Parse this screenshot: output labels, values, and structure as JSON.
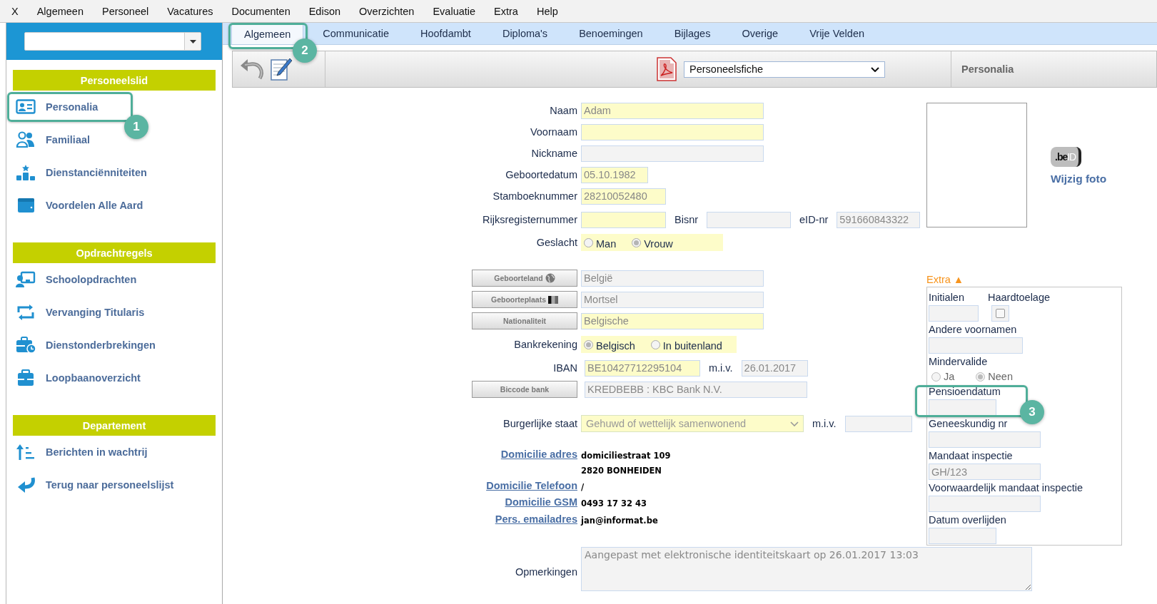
{
  "menu": [
    "X",
    "Algemeen",
    "Personeel",
    "Vacatures",
    "Documenten",
    "Edison",
    "Overzichten",
    "Evaluatie",
    "Extra",
    "Help"
  ],
  "sidebar": {
    "sections": [
      {
        "title": "Personeelslid",
        "items": [
          "Personalia",
          "Familiaal",
          "Dienstanciënniteiten",
          "Voordelen Alle Aard"
        ]
      },
      {
        "title": "Opdrachtregels",
        "items": [
          "Schoolopdrachten",
          "Vervanging Titularis",
          "Dienstonderbrekingen",
          "Loopbaanoverzicht"
        ]
      },
      {
        "title": "Departement",
        "items": [
          "Berichten in wachtrij",
          "Terug naar personeelslijst"
        ]
      }
    ]
  },
  "tabs": [
    {
      "label": "Algemeen",
      "selected": true
    },
    {
      "label": "Communicatie",
      "selected": false
    },
    {
      "label": "Hoofdambt",
      "selected": false
    },
    {
      "label": "Diploma's",
      "selected": false
    },
    {
      "label": "Benoemingen",
      "selected": false
    },
    {
      "label": "Bijlages",
      "selected": false
    },
    {
      "label": "Overige",
      "selected": false
    },
    {
      "label": "Vrije Velden",
      "selected": false
    }
  ],
  "toolbar": {
    "report": "Personeelsfiche",
    "title": "Personalia"
  },
  "form": {
    "rows": [
      {
        "kind": "fields",
        "label": "Naam",
        "items": [
          {
            "kind": "input",
            "value": "Adam",
            "required": true
          }
        ]
      },
      {
        "kind": "fields",
        "label": "Voornaam",
        "items": [
          {
            "kind": "input",
            "required": true
          }
        ]
      },
      {
        "kind": "fields",
        "label": "Nickname",
        "items": [
          {
            "kind": "input",
            "required": false
          }
        ]
      },
      {
        "kind": "fields",
        "label": "Geboortedatum",
        "items": [
          {
            "kind": "input",
            "value": "05.10.1982",
            "required": true
          }
        ]
      },
      {
        "kind": "fields",
        "label": "Stamboeknummer",
        "items": [
          {
            "kind": "input",
            "value": "28210052480",
            "required": true
          }
        ]
      },
      {
        "kind": "fields",
        "label": "Rijksregisternummer",
        "items": [
          {
            "kind": "input",
            "required": true
          },
          {
            "kind": "label",
            "text": "Bisnr"
          },
          {
            "kind": "input",
            "required": false
          },
          {
            "kind": "label",
            "text": "eID-nr"
          },
          {
            "kind": "input",
            "value": "591660843322",
            "required": false
          }
        ]
      },
      {
        "kind": "radios",
        "label": "Geslacht",
        "required": true,
        "options": [
          {
            "label": "Man",
            "selected": false
          },
          {
            "label": "Vrouw",
            "selected": true
          }
        ]
      },
      {
        "kind": "lookup",
        "button": "Geboorteland",
        "disabled": true,
        "items": [
          {
            "kind": "input",
            "value": "België",
            "required": false
          }
        ]
      },
      {
        "kind": "lookup",
        "button": "Geboorteplaats",
        "disabled": true,
        "items": [
          {
            "kind": "input",
            "value": "Mortsel",
            "required": false
          }
        ]
      },
      {
        "kind": "lookup",
        "button": "Nationaliteit",
        "disabled": true,
        "items": [
          {
            "kind": "input",
            "value": "Belgische",
            "required": true
          }
        ]
      },
      {
        "kind": "radios",
        "label": "Bankrekening",
        "required": true,
        "options": [
          {
            "label": "Belgisch",
            "selected": true
          },
          {
            "label": "In buitenland",
            "selected": false
          }
        ]
      },
      {
        "kind": "fields",
        "label": "IBAN",
        "items": [
          {
            "kind": "input",
            "value": "BE10427712295104",
            "required": true
          },
          {
            "kind": "label",
            "text": "m.i.v."
          },
          {
            "kind": "input",
            "value": "26.01.2017",
            "required": false
          }
        ]
      },
      {
        "kind": "lookup",
        "button": "Biccode bank",
        "disabled": true,
        "items": [
          {
            "kind": "input",
            "value": "KREDBEBB : KBC Bank N.V.",
            "required": false
          }
        ]
      },
      {
        "kind": "fields",
        "label": "Burgerlijke staat",
        "items": [
          {
            "kind": "select",
            "value": "Gehuwd of wettelijk samenwonend",
            "required": true
          },
          {
            "kind": "label",
            "text": "m.i.v."
          },
          {
            "kind": "input",
            "required": false
          }
        ]
      },
      {
        "kind": "link",
        "label": "Domicilie adres",
        "lines": [
          "domiciliestraat 109",
          "2820 BONHEIDEN"
        ]
      },
      {
        "kind": "link",
        "label": "Domicilie Telefoon",
        "lines": [
          "/"
        ]
      },
      {
        "kind": "link",
        "label": "Domicilie GSM",
        "lines": [
          "0493 17 32 43"
        ]
      },
      {
        "kind": "link",
        "label": "Pers. emailadres",
        "lines": [
          "jan@informat.be"
        ]
      },
      {
        "kind": "textarea",
        "label": "Opmerkingen",
        "value": "Aangepast met elektronische identiteitskaart op 26.01.2017 13:03"
      }
    ]
  },
  "photo": {
    "logo": [
      ".be",
      "ID"
    ],
    "link": "Wijzig foto"
  },
  "extra": {
    "title": "Extra",
    "toggle": "▲",
    "fields": [
      {
        "kind": "input",
        "label": "Initialen"
      },
      {
        "kind": "checkbox",
        "label": "Haardtoelage",
        "checked": false
      },
      {
        "kind": "input",
        "label": "Andere voornamen"
      },
      {
        "kind": "radios",
        "label": "Mindervalide",
        "options": [
          {
            "label": "Ja",
            "selected": false
          },
          {
            "label": "Neen",
            "selected": true
          }
        ]
      },
      {
        "kind": "input",
        "label": "Pensioendatum"
      },
      {
        "kind": "input",
        "label": "Geneeskundig nr"
      },
      {
        "kind": "input",
        "label": "Mandaat inspectie",
        "value": "GH/123"
      },
      {
        "kind": "input",
        "label": "Voorwaardelijk mandaat inspectie"
      },
      {
        "kind": "input",
        "label": "Datum overlijden"
      }
    ]
  },
  "callouts": [
    "1",
    "2",
    "3"
  ]
}
